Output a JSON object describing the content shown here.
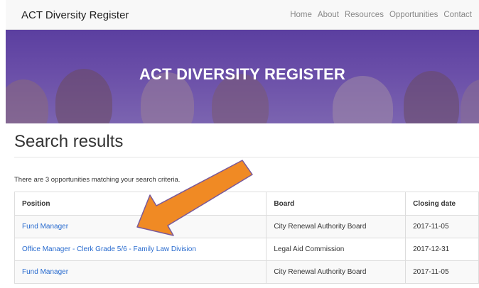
{
  "navbar": {
    "brand": "ACT Diversity Register",
    "links": [
      "Home",
      "About",
      "Resources",
      "Opportunities",
      "Contact"
    ]
  },
  "hero": {
    "title": "ACT DIVERSITY REGISTER"
  },
  "page": {
    "title": "Search results",
    "summary": "There are 3 opportunities matching your search criteria."
  },
  "results": {
    "headers": [
      "Position",
      "Board",
      "Closing date"
    ],
    "rows": [
      {
        "position": "Fund Manager",
        "board": "City Renewal Authority Board",
        "closing": "2017-11-05"
      },
      {
        "position": "Office Manager - Clerk Grade 5/6 - Family Law Division",
        "board": "Legal Aid Commission",
        "closing": "2017-12-31"
      },
      {
        "position": "Fund Manager",
        "board": "City Renewal Authority Board",
        "closing": "2017-11-05"
      }
    ]
  },
  "colors": {
    "hero": "#6a4ea8",
    "link": "#2a6ccf",
    "arrow": "#f08a24"
  }
}
